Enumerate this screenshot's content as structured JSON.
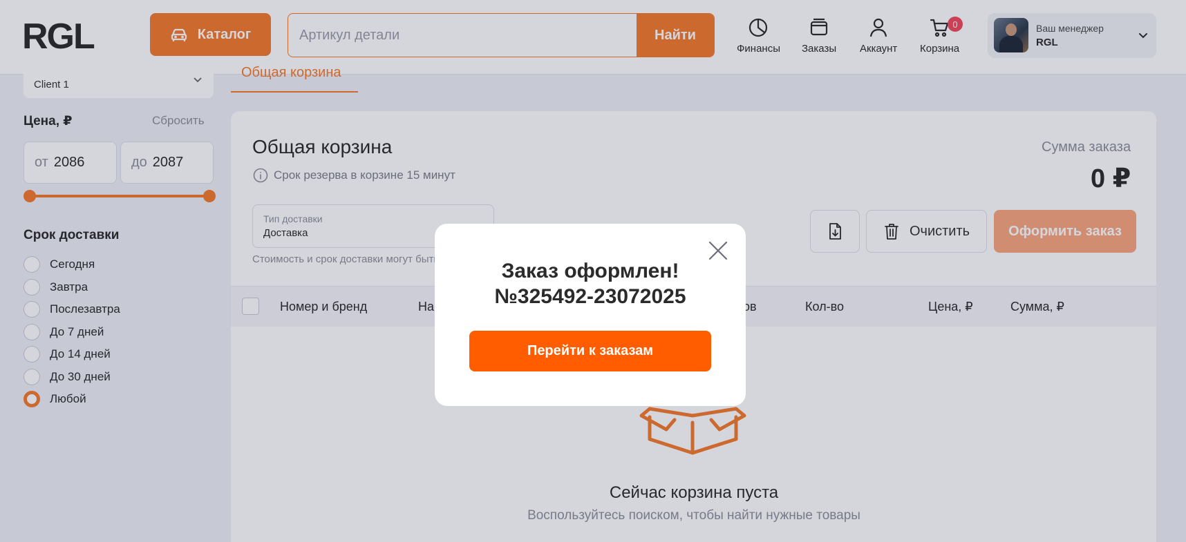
{
  "header": {
    "logo_text": "RGL",
    "catalog_label": "Каталог",
    "search_placeholder": "Артикул детали",
    "search_button": "Найти",
    "nav": {
      "finance": "Финансы",
      "orders": "Заказы",
      "account": "Аккаунт",
      "cart": "Корзина",
      "cart_count": "0"
    },
    "manager_label": "Ваш менеджер",
    "manager_name": "RGL"
  },
  "sidebar": {
    "client": "Client 1",
    "price_title": "Цена, ₽",
    "reset": "Сбросить",
    "price_from_prefix": "от",
    "price_from": "2086",
    "price_to_prefix": "до",
    "price_to": "2087",
    "delivery_title": "Срок доставки",
    "delivery_options": [
      "Сегодня",
      "Завтра",
      "Послезавтра",
      "До 7 дней",
      "До 14 дней",
      "До 30 дней",
      "Любой"
    ],
    "delivery_selected": "Любой"
  },
  "main": {
    "tab": "Общая корзина",
    "title": "Общая корзина",
    "reserve_note": "Срок резерва в корзине 15 минут",
    "sum_label": "Сумма заказа",
    "sum_value": "0 ₽",
    "delivery_type_label": "Тип доставки",
    "delivery_type_value": "Доставка",
    "delivery_note": "Стоимость и срок доставки могут быть изменены",
    "clear_label": "Очистить",
    "order_label": "Оформить заказ",
    "columns": [
      "Номер и бренд",
      "На",
      "ов",
      "Кол-во",
      "Цена, ₽",
      "Сумма, ₽"
    ],
    "empty_title": "Сейчас корзина пуста",
    "empty_sub": "Воспользуйтесь поиском, чтобы найти нужные товары"
  },
  "modal": {
    "title_line1": "Заказ оформлен!",
    "title_line2": "№325492-23072025",
    "button": "Перейти к заказам"
  },
  "colors": {
    "accent": "#f57a2c",
    "modal_button": "#ff5d00",
    "badge": "#f2485a"
  }
}
